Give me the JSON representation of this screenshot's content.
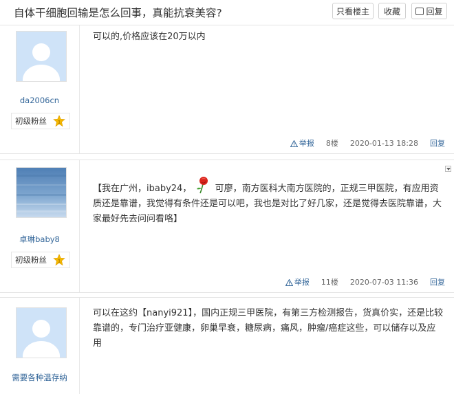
{
  "thread": {
    "title": "自体干细胞回输是怎么回事，真能抗衰美容?",
    "buttons": {
      "only_op": "只看楼主",
      "favorite": "收藏",
      "reply": "回复"
    }
  },
  "posts": [
    {
      "username": "da2006cn",
      "rank": "初级粉丝",
      "rank_level": "1",
      "avatar": "default-avatar",
      "content": "可以的,价格应该在20万以内",
      "report": "举报",
      "floor": "8楼",
      "time": "2020-01-13 18:28",
      "reply": "回复"
    },
    {
      "username": "卓琳baby8",
      "rank": "初级粉丝",
      "rank_level": "1",
      "avatar": "blue-texture-avatar",
      "content_before": "【我在广州，ibaby24，",
      "content_after": "可廖，南方医科大南方医院的，正规三甲医院，有应用资质还是靠谱，我觉得有条件还是可以吧，我也是对比了好几家，还是觉得去医院靠谱，大家最好先去问问看咯】",
      "report": "举报",
      "floor": "11楼",
      "time": "2020-07-03 11:36",
      "reply": "回复"
    },
    {
      "username": "需要各种温存纳",
      "avatar": "default-avatar",
      "content": "可以在这约【nanyi921】，国内正规三甲医院，有第三方检测报告，货真价实，还是比较靠谱的，专门治疗亚健康，卵巢早衰，糖尿病，痛风，肿瘤/癌症这些，可以储存以及应用"
    }
  ],
  "colors": {
    "link": "#336699",
    "avatar_bg": "#cfe3f8",
    "border": "#e4e4e4",
    "star": "#f5b800"
  }
}
